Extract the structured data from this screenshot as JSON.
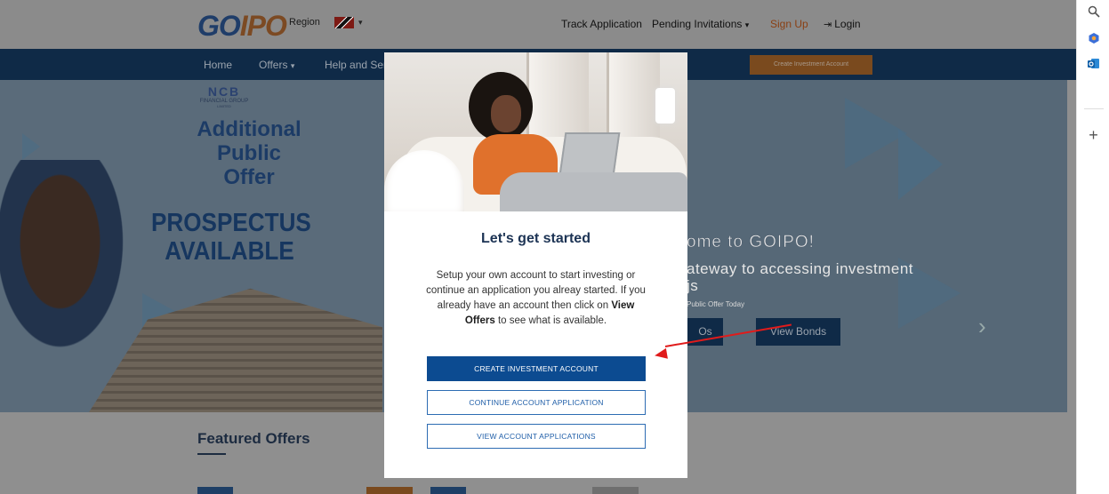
{
  "header": {
    "logo_go": "GO",
    "logo_ipo": "IPO",
    "region_label": "Region",
    "region_caret": "▾",
    "nav": {
      "track_application": "Track Application",
      "pending_invitations": "Pending Invitations",
      "pending_caret": "▾",
      "sign_up": "Sign Up",
      "login_icon": "⇥",
      "login": "Login"
    }
  },
  "navbar": {
    "home": "Home",
    "offers": "Offers",
    "offers_caret": "▾",
    "help": "Help and Ser",
    "create_account": "Create Investment Account"
  },
  "hero": {
    "brand_mark": "NCB",
    "brand_line1": "FINANCIAL GROUP",
    "brand_line2": "LIMITED",
    "headline": "Additional Public Offer",
    "headline_lines": [
      "Additional",
      "Public",
      "Offer"
    ],
    "prospectus_lines": [
      "PROSPECTUS",
      "AVAILABLE"
    ],
    "welcome": "ome to GOIPO!",
    "subtitle_lines": [
      "ateway to accessing investment",
      "js"
    ],
    "small_text": "Public Offer Today",
    "btn_ipos": "Os",
    "btn_bonds": "View Bonds",
    "next_arrow": "›"
  },
  "featured": {
    "title": "Featured Offers"
  },
  "modal": {
    "title": "Let's get started",
    "body_pre": "Setup your own account to start investing or continue an application you alreay started. If you already have an account then click on",
    "body_bold": "View Offers",
    "body_post": "to see what is available.",
    "btn_create": "CREATE INVESTMENT ACCOUNT",
    "btn_continue": "CONTINUE ACCOUNT APPLICATION",
    "btn_view": "VIEW ACCOUNT APPLICATIONS"
  },
  "sidebar_icons": {
    "search": "search-icon",
    "copilot": "copilot-icon",
    "outlook": "outlook-icon",
    "add": "+"
  },
  "colors": {
    "navy": "#0f2a47",
    "primary_button": "#0c4b91",
    "annotation_arrow": "#e01b1b",
    "orange_cta": "#7a4a1e"
  }
}
